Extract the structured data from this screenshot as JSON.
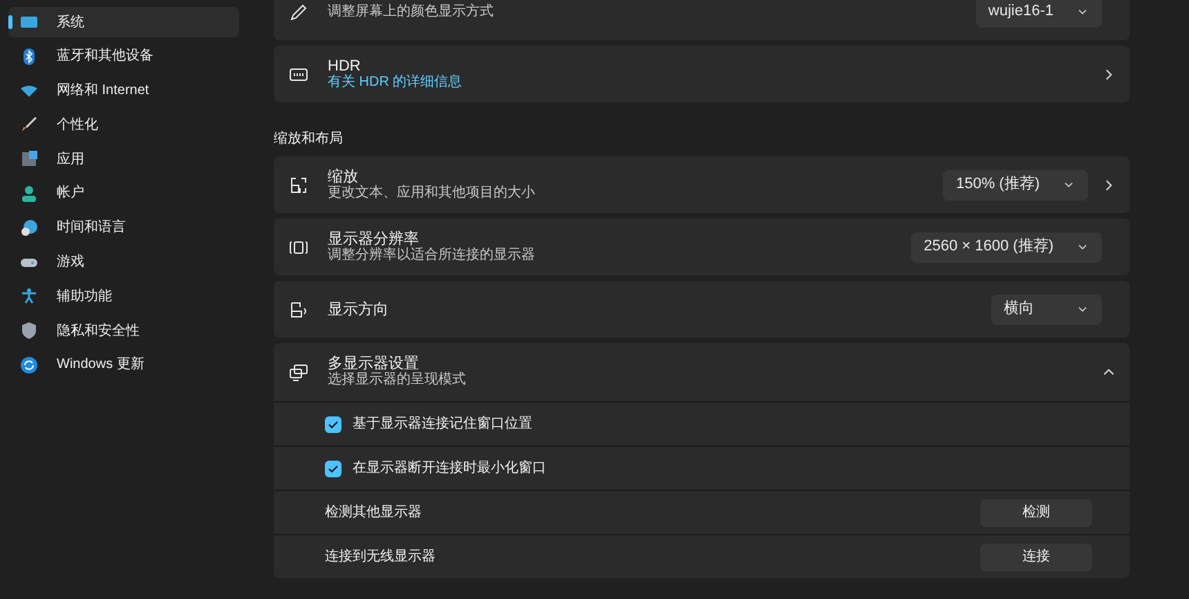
{
  "sidebar": {
    "items": [
      {
        "label": "系统",
        "selected": true
      },
      {
        "label": "蓝牙和其他设备",
        "selected": false
      },
      {
        "label": "网络和 Internet",
        "selected": false
      },
      {
        "label": "个性化",
        "selected": false
      },
      {
        "label": "应用",
        "selected": false
      },
      {
        "label": "帐户",
        "selected": false
      },
      {
        "label": "时间和语言",
        "selected": false
      },
      {
        "label": "游戏",
        "selected": false
      },
      {
        "label": "辅助功能",
        "selected": false
      },
      {
        "label": "隐私和安全性",
        "selected": false
      },
      {
        "label": "Windows 更新",
        "selected": false
      }
    ]
  },
  "top_cards": [
    {
      "kind": "dropdown",
      "subtitle": "调整屏幕上的颜色显示方式",
      "value": "wujie16-1"
    },
    {
      "kind": "link",
      "title": "HDR",
      "link": "有关 HDR 的详细信息"
    }
  ],
  "section": {
    "heading": "缩放和布局"
  },
  "cards": [
    {
      "kind": "dropdown_link",
      "title": "缩放",
      "subtitle": "更改文本、应用和其他项目的大小",
      "value": "150% (推荐)"
    },
    {
      "kind": "dropdown",
      "title": "显示器分辨率",
      "subtitle": "调整分辨率以适合所连接的显示器",
      "value": "2560 × 1600 (推荐)"
    },
    {
      "kind": "dropdown",
      "title": "显示方向",
      "value": "横向"
    }
  ],
  "multi_display": {
    "title": "多显示器设置",
    "subtitle": "选择显示器的呈现模式",
    "expanded": true,
    "rows": [
      {
        "kind": "checkbox",
        "label": "基于显示器连接记住窗口位置",
        "checked": true
      },
      {
        "kind": "checkbox",
        "label": "在显示器断开连接时最小化窗口",
        "checked": true
      },
      {
        "kind": "button",
        "label": "检测其他显示器",
        "button": "检测"
      },
      {
        "kind": "button",
        "label": "连接到无线显示器",
        "button": "连接"
      }
    ]
  }
}
